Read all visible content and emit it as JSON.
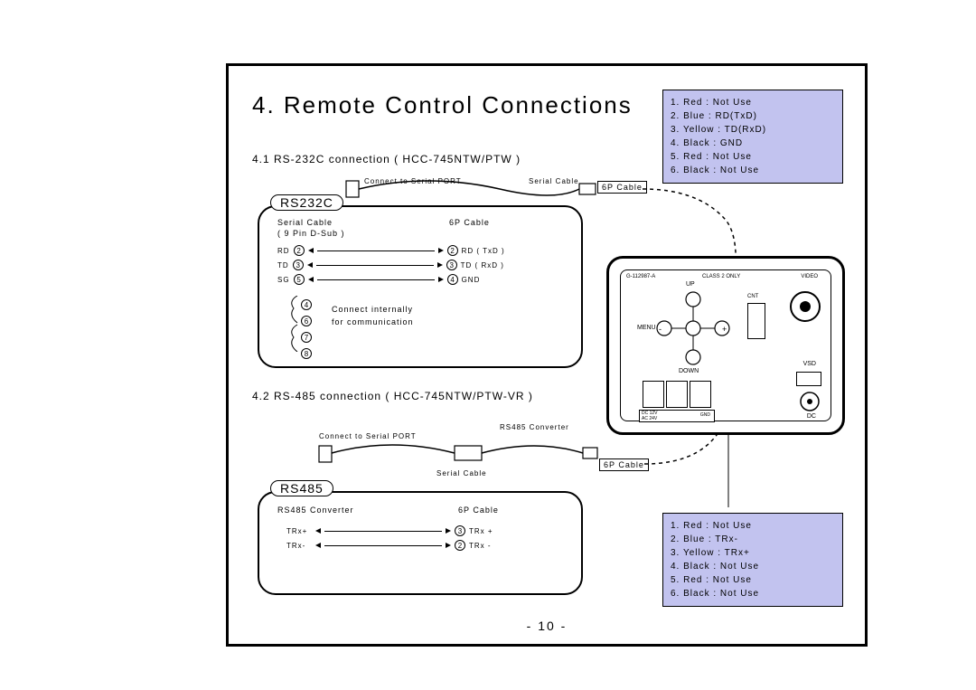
{
  "title": "4. Remote Control Connections",
  "sub1": "4.1 RS-232C connection ( HCC-745NTW/PTW )",
  "sub2": "4.2 RS-485 connection ( HCC-745NTW/PTW-VR )",
  "legend_rs232": {
    "l1": "1. Red : Not Use",
    "l2": "2. Blue : RD(TxD)",
    "l3": "3. Yellow : TD(RxD)",
    "l4": "4. Black : GND",
    "l5": "5. Red : Not Use",
    "l6": "6. Black : Not Use"
  },
  "legend_rs485": {
    "l1": "1. Red : Not Use",
    "l2": "2. Blue : TRx-",
    "l3": "3. Yellow : TRx+",
    "l4": "4. Black : Not Use",
    "l5": "5. Red : Not Use",
    "l6": "6. Black : Not Use"
  },
  "rs232c": {
    "tab": "RS232C",
    "col_left_h": "Serial Cable",
    "col_left_sub": "( 9 Pin D-Sub )",
    "col_right_h": "6P Cable",
    "rows": {
      "r1_l": "RD",
      "r1_ln": "2",
      "r1_rn": "2",
      "r1_r": "RD ( TxD )",
      "r2_l": "TD",
      "r2_ln": "3",
      "r2_rn": "3",
      "r2_r": "TD ( RxD )",
      "r3_l": "SG",
      "r3_ln": "5",
      "r3_rn": "4",
      "r3_r": "GND"
    },
    "extras": [
      "4",
      "6",
      "7",
      "8"
    ],
    "note_a": "Connect internally",
    "note_b": "for communication"
  },
  "rs485": {
    "tab": "RS485",
    "col_left_h": "RS485 Converter",
    "col_right_h": "6P Cable",
    "rows": {
      "r1_l": "TRx+",
      "r1_rn": "3",
      "r1_r": "TRx +",
      "r2_l": "TRx-",
      "r2_rn": "2",
      "r2_r": "TRx -"
    }
  },
  "labels": {
    "connect_serial_1": "Connect to Serial PORT",
    "connect_serial_2": "Connect to Serial PORT",
    "serial_cable_1": "Serial Cable",
    "serial_cable_2": "Serial Cable",
    "cab6p_1": "6P Cable",
    "cab6p_2": "6P Cable",
    "rs485_conv": "RS485 Converter"
  },
  "device": {
    "board": "G-112987-A",
    "class": "CLASS 2 ONLY",
    "video": "VIDEO",
    "up": "UP",
    "down": "DOWN",
    "menu": "MENU",
    "minus": "-",
    "plus": "+",
    "cnt": "CNT",
    "vsd": "VSD",
    "dc": "DC",
    "ac_top": "DC 12V",
    "ac_bot": "AC 24V",
    "gnd": "GND"
  },
  "page": "- 10 -"
}
